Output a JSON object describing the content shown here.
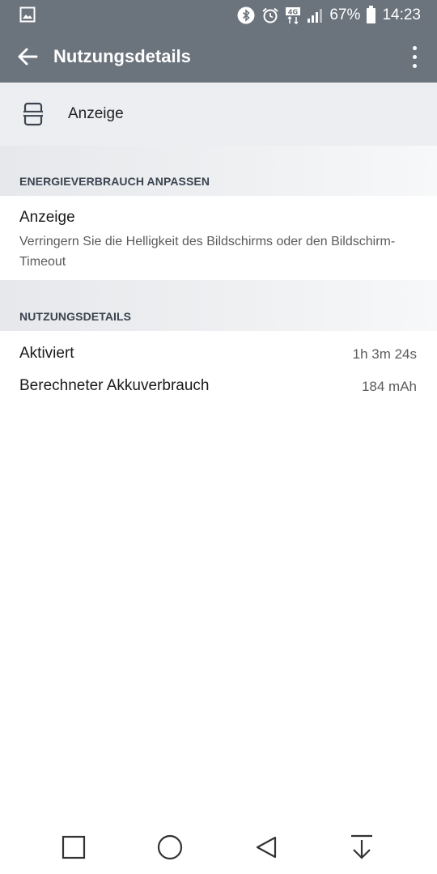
{
  "status_bar": {
    "battery_percent": "67%",
    "time": "14:23",
    "network": "4G",
    "icons": [
      "image-icon",
      "bluetooth-icon",
      "alarm-icon",
      "network-4g-icon",
      "signal-icon",
      "battery-icon"
    ]
  },
  "app_bar": {
    "title": "Nutzungsdetails",
    "back_icon": "arrow-back-icon",
    "overflow_icon": "more-vert-icon"
  },
  "app_row": {
    "label": "Anzeige",
    "icon": "display-icon"
  },
  "sections": {
    "adjust": {
      "header": "ENERGIEVERBRAUCH ANPASSEN",
      "item": {
        "title": "Anzeige",
        "description": "Verringern Sie die Helligkeit des Bildschirms oder den Bildschirm-Timeout"
      }
    },
    "usage": {
      "header": "NUTZUNGSDETAILS",
      "rows": [
        {
          "label": "Aktiviert",
          "value": "1h 3m 24s"
        },
        {
          "label": "Berechneter Akkuverbrauch",
          "value": "184 mAh"
        }
      ]
    }
  },
  "colors": {
    "toolbar": "#6b737c",
    "row_background": "#eceef1",
    "section_header_text": "#3b4450"
  },
  "nav_bar": {
    "icons": [
      "recents-square-icon",
      "home-circle-icon",
      "back-triangle-icon",
      "notification-pull-icon"
    ]
  }
}
